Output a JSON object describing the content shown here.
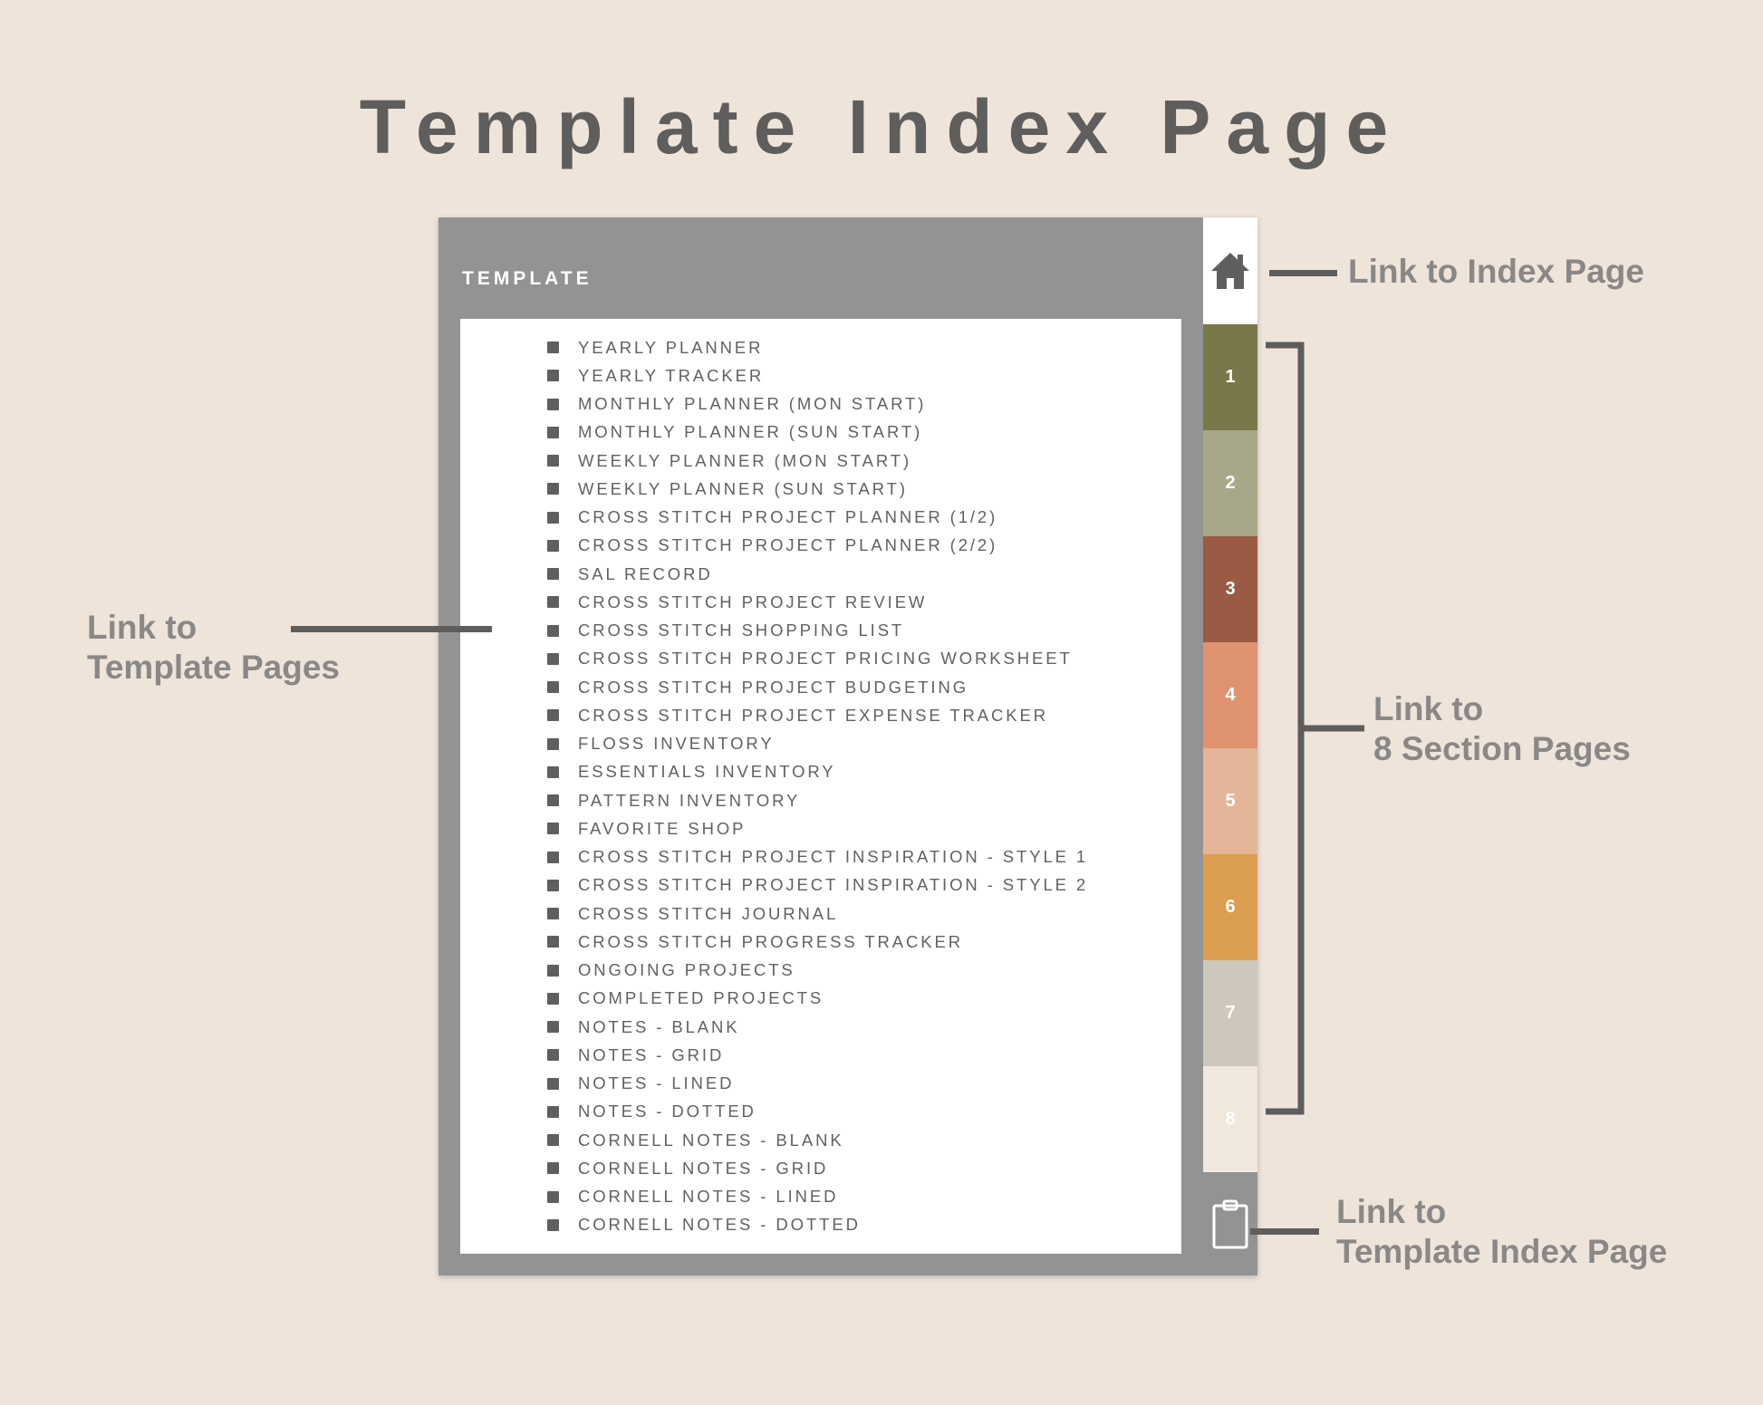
{
  "title": "Template Index Page",
  "planner": {
    "header_label": "TEMPLATE",
    "items": [
      "YEARLY PLANNER",
      "YEARLY TRACKER",
      "MONTHLY PLANNER (MON START)",
      "MONTHLY PLANNER (SUN START)",
      "WEEKLY PLANNER (MON START)",
      "WEEKLY PLANNER (SUN START)",
      "CROSS STITCH PROJECT PLANNER (1/2)",
      "CROSS STITCH PROJECT PLANNER (2/2)",
      "SAL RECORD",
      "CROSS STITCH PROJECT REVIEW",
      "CROSS STITCH SHOPPING LIST",
      "CROSS STITCH PROJECT PRICING WORKSHEET",
      "CROSS STITCH PROJECT BUDGETING",
      "CROSS STITCH PROJECT EXPENSE TRACKER",
      "FLOSS INVENTORY",
      "ESSENTIALS INVENTORY",
      "PATTERN INVENTORY",
      "FAVORITE SHOP",
      "CROSS STITCH PROJECT INSPIRATION - STYLE 1",
      "CROSS STITCH PROJECT INSPIRATION - STYLE 2",
      "CROSS STITCH JOURNAL",
      "CROSS STITCH PROGRESS TRACKER",
      "ONGOING PROJECTS",
      "COMPLETED PROJECTS",
      "NOTES - BLANK",
      "NOTES - GRID",
      "NOTES - LINED",
      "NOTES - DOTTED",
      "CORNELL NOTES - BLANK",
      "CORNELL NOTES - GRID",
      "CORNELL NOTES - LINED",
      "CORNELL NOTES - DOTTED"
    ],
    "tabs": [
      {
        "label": "1",
        "color": "#78784a"
      },
      {
        "label": "2",
        "color": "#a8a78a"
      },
      {
        "label": "3",
        "color": "#9a5a43"
      },
      {
        "label": "4",
        "color": "#df9370"
      },
      {
        "label": "5",
        "color": "#e4b599"
      },
      {
        "label": "6",
        "color": "#dc9e51"
      },
      {
        "label": "7",
        "color": "#cdc8bb"
      },
      {
        "label": "8",
        "color": "#f0e7dd"
      }
    ],
    "home_icon": "home-icon",
    "clipboard_icon": "clipboard-icon"
  },
  "callouts": {
    "index": "Link to Index Page",
    "templates_line1": "Link to",
    "templates_line2": "Template Pages",
    "sections_line1": "Link to",
    "sections_line2": "8 Section Pages",
    "template_index_line1": "Link to",
    "template_index_line2": "Template Index Page"
  },
  "colors": {
    "background": "#efe4da",
    "frame": "#939393",
    "text_dark": "#5f5e5d",
    "callout_text": "#8a8887"
  }
}
